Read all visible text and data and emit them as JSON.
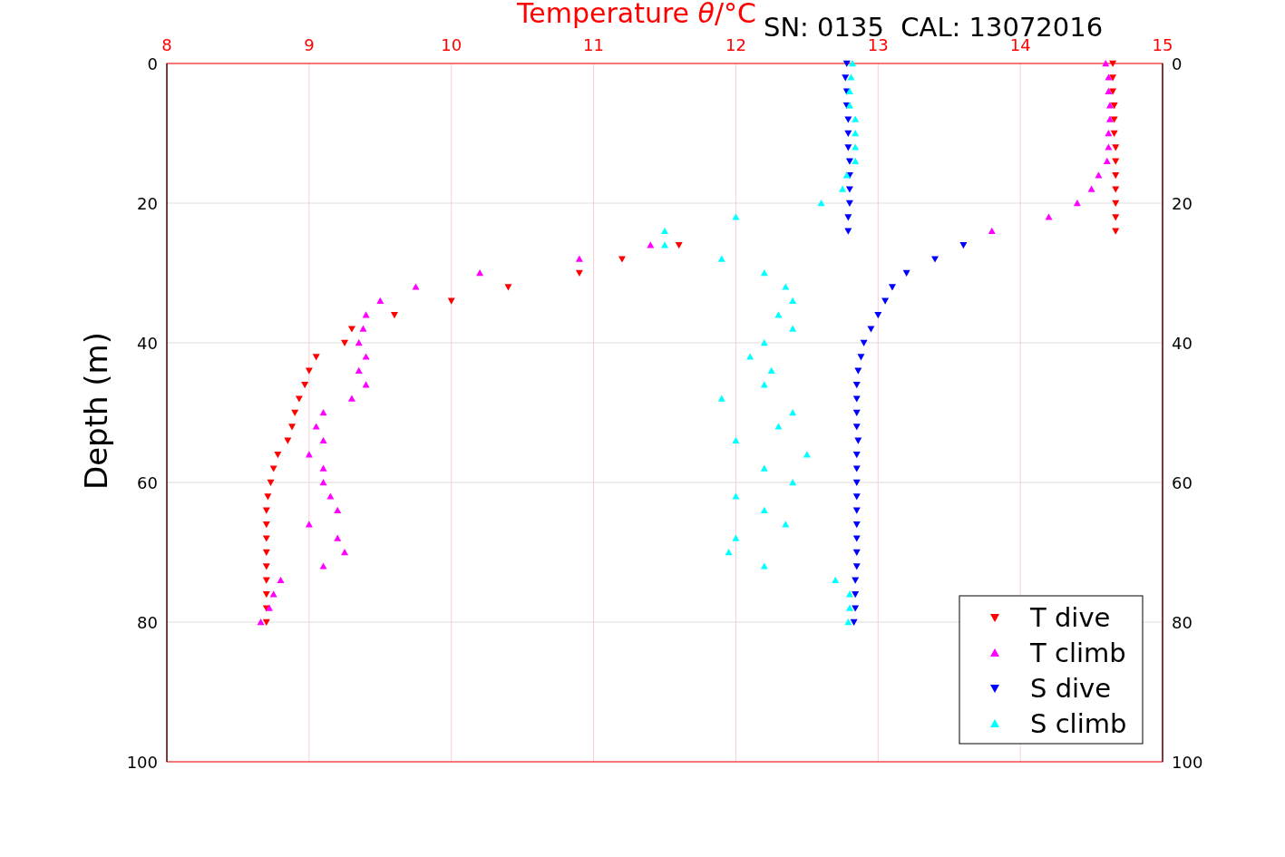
{
  "figure": {
    "subtitle": "SN: 0135  CAL: 13072016",
    "right_axis_ticks": [
      "0",
      "20",
      "40",
      "60",
      "80",
      "100"
    ],
    "marker_directions": [
      {
        "pointing_down": true
      },
      {
        "pointing_down": false
      },
      {
        "pointing_down": true
      },
      {
        "pointing_down": false
      }
    ],
    "chart_data": {
      "type": "scatter",
      "orientation": "horizontal",
      "grid": true,
      "legend": true,
      "xlabel": "Temperature *θ*/°C",
      "ylabel": "Depth (m)",
      "xlim": [
        8,
        15
      ],
      "ylim": [
        100,
        0
      ],
      "xticks": [
        8,
        9,
        10,
        11,
        12,
        13,
        14,
        15
      ],
      "yticks": [
        {
          "value": 0,
          "label": "0"
        },
        {
          "value": 20,
          "label": "20"
        },
        {
          "value": 40,
          "label": "40"
        },
        {
          "value": 60,
          "label": "60"
        },
        {
          "value": 80,
          "label": "80"
        },
        {
          "value": 100,
          "label": "100"
        }
      ],
      "x": [
        0,
        2,
        4,
        6,
        8,
        10,
        12,
        14,
        16,
        18,
        20,
        22,
        24,
        26,
        28,
        30,
        32,
        34,
        36,
        38,
        40,
        42,
        44,
        46,
        48,
        50,
        52,
        54,
        56,
        58,
        60,
        62,
        64,
        66,
        68,
        70,
        72,
        74,
        76,
        78,
        80
      ],
      "series": [
        {
          "name": "T dive",
          "color": "#ff0000",
          "marker": "triangle",
          "values": [
            14.65,
            14.65,
            14.65,
            14.66,
            14.66,
            14.66,
            14.67,
            14.67,
            14.67,
            14.67,
            14.67,
            14.67,
            14.67,
            11.6,
            11.2,
            10.9,
            10.4,
            10.0,
            9.6,
            9.3,
            9.25,
            9.05,
            9.0,
            8.97,
            8.93,
            8.9,
            8.88,
            8.85,
            8.78,
            8.75,
            8.73,
            8.71,
            8.7,
            8.7,
            8.7,
            8.7,
            8.7,
            8.7,
            8.7,
            8.7,
            8.7
          ]
        },
        {
          "name": "T climb",
          "color": "#ff00ff",
          "marker": "triangle",
          "values": [
            14.6,
            14.62,
            14.62,
            14.63,
            14.63,
            14.62,
            14.62,
            14.61,
            14.55,
            14.5,
            14.4,
            14.2,
            13.8,
            11.4,
            10.9,
            10.2,
            9.75,
            9.5,
            9.4,
            9.38,
            9.35,
            9.4,
            9.35,
            9.4,
            9.3,
            9.1,
            9.05,
            9.1,
            9.0,
            9.1,
            9.1,
            9.15,
            9.2,
            9.0,
            9.2,
            9.25,
            9.1,
            8.8,
            8.75,
            8.72,
            8.66
          ]
        },
        {
          "name": "S dive",
          "color": "#0000ff",
          "marker": "triangle",
          "values": [
            12.78,
            12.77,
            12.78,
            12.78,
            12.79,
            12.79,
            12.79,
            12.8,
            12.8,
            12.8,
            12.8,
            12.79,
            12.79,
            13.6,
            13.4,
            13.2,
            13.1,
            13.05,
            13.0,
            12.95,
            12.9,
            12.88,
            12.86,
            12.85,
            12.85,
            12.85,
            12.85,
            12.86,
            12.85,
            12.85,
            12.85,
            12.85,
            12.85,
            12.85,
            12.85,
            12.85,
            12.85,
            12.84,
            12.84,
            12.84,
            12.83
          ]
        },
        {
          "name": "S climb",
          "color": "#00ffff",
          "marker": "triangle",
          "values": [
            12.82,
            12.81,
            12.8,
            12.8,
            12.84,
            12.84,
            12.84,
            12.84,
            12.78,
            12.75,
            12.6,
            12.0,
            11.5,
            11.5,
            11.9,
            12.2,
            12.35,
            12.4,
            12.3,
            12.4,
            12.2,
            12.1,
            12.25,
            12.2,
            11.9,
            12.4,
            12.3,
            12.0,
            12.5,
            12.2,
            12.4,
            12.0,
            12.2,
            12.35,
            12.0,
            11.95,
            12.2,
            12.7,
            12.8,
            12.8,
            12.79
          ]
        }
      ]
    }
  }
}
